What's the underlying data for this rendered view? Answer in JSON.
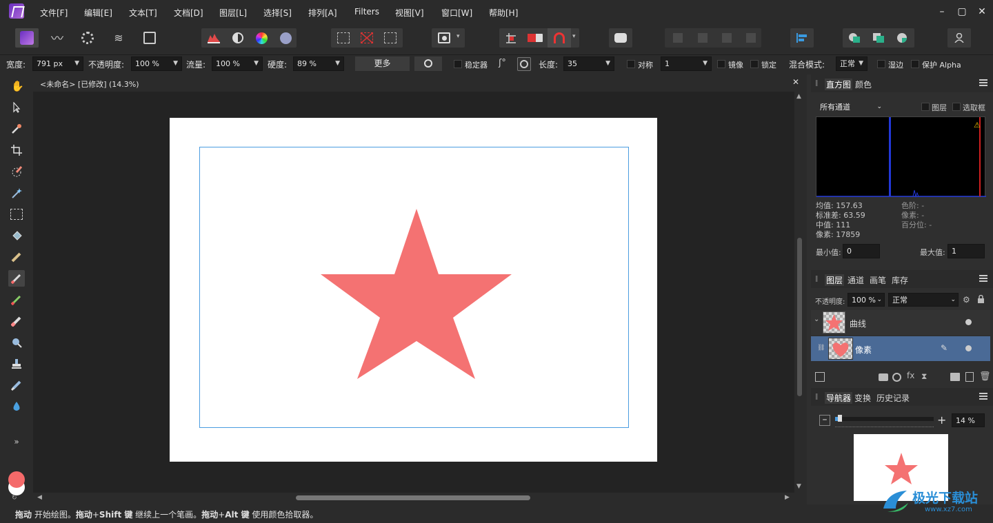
{
  "menubar": {
    "items": [
      "文件[F]",
      "编辑[E]",
      "文本[T]",
      "文档[D]",
      "图层[L]",
      "选择[S]",
      "排列[A]",
      "Filters",
      "视图[V]",
      "窗口[W]",
      "帮助[H]"
    ],
    "window_controls": [
      "minimize-icon",
      "maximize-icon",
      "close-icon"
    ]
  },
  "context_bar": {
    "width_label": "宽度:",
    "width_value": "791 px",
    "opacity_label": "不透明度:",
    "opacity_value": "100 %",
    "flow_label": "流量:",
    "flow_value": "100 %",
    "hardness_label": "硬度:",
    "hardness_value": "89 %",
    "more_label": "更多",
    "stabilizer_label": "稳定器",
    "length_label": "长度:",
    "length_value": "35",
    "symmetry_label": "对称",
    "symmetry_value": "1",
    "mirror_label": "镜像",
    "lock_label": "锁定",
    "blend_label": "混合模式:",
    "blend_value": "正常",
    "wet_edges_label": "湿边",
    "protect_alpha_label": "保护 Alpha"
  },
  "document": {
    "tab_title": "<未命名> [已修改] (14.3%)",
    "star_color": "#f47272",
    "selection_color": "#4a9ce0"
  },
  "histogram_panel": {
    "tabs": [
      "直方图",
      "颜色"
    ],
    "channel_select": "所有通道",
    "layer_checkbox": "图层",
    "marquee_checkbox": "选取框",
    "stats_left": [
      "均值: 157.63",
      "标准差: 63.59",
      "中值: 111",
      "像素: 17859"
    ],
    "stats_right": [
      "色阶: -",
      "像素: -",
      "百分位: -"
    ],
    "min_label": "最小值:",
    "min_value": "0",
    "max_label": "最大值:",
    "max_value": "1"
  },
  "layers_panel": {
    "tabs": [
      "图层",
      "通道",
      "画笔",
      "库存"
    ],
    "opacity_label": "不透明度:",
    "opacity_value": "100 %",
    "blend_value": "正常",
    "layers": [
      {
        "name": "曲线",
        "selected": false
      },
      {
        "name": "像素",
        "selected": true
      }
    ]
  },
  "navigator_panel": {
    "tabs": [
      "导航器",
      "变换",
      "历史记录"
    ],
    "zoom_value": "14 %",
    "zoom_fraction": 0.05
  },
  "status_bar": {
    "segments": [
      {
        "text": "拖动",
        "bold": true
      },
      {
        "text": " 开始绘图。",
        "bold": false
      },
      {
        "text": "拖动",
        "bold": true
      },
      {
        "text": "+",
        "bold": false
      },
      {
        "text": "Shift 键",
        "bold": true
      },
      {
        "text": " 继续上一个笔画。",
        "bold": false
      },
      {
        "text": "拖动",
        "bold": true
      },
      {
        "text": "+",
        "bold": false
      },
      {
        "text": "Alt 键",
        "bold": true
      },
      {
        "text": " 使用颜色拾取器。",
        "bold": false
      }
    ]
  },
  "watermark": {
    "text": "极光下载站",
    "url": "www.xz7.com"
  },
  "colors": {
    "accent": "#4a6a96",
    "primary_swatch": "#f46a6a",
    "secondary_swatch": "#ffffff"
  }
}
